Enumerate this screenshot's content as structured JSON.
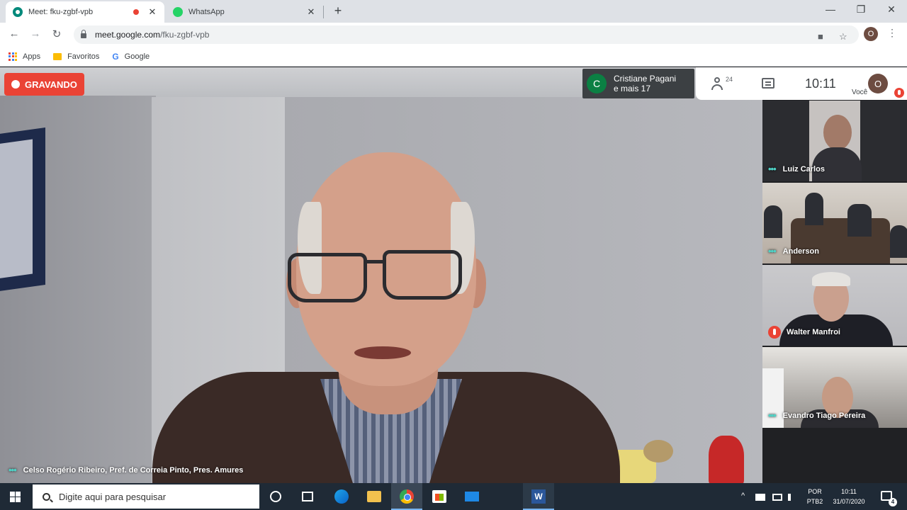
{
  "browser": {
    "tabs": [
      {
        "title": "Meet: fku-zgbf-vpb",
        "close": "✕",
        "recording": true
      },
      {
        "title": "WhatsApp",
        "close": "✕"
      }
    ],
    "new_tab": "+",
    "window_controls": {
      "minimize": "—",
      "maximize": "❐",
      "close": "✕"
    },
    "nav": {
      "back": "←",
      "forward": "→",
      "reload": "↻"
    },
    "url_host": "meet.google.com",
    "url_path": "/fku-zgbf-vpb",
    "profile_initial": "O",
    "menu": "⋮",
    "omnibox_icons": {
      "camera": "■",
      "star": "☆"
    },
    "bookmarks": [
      {
        "label": "Apps",
        "icon": "apps-grid-icon"
      },
      {
        "label": "Favoritos",
        "icon": "folder-icon"
      },
      {
        "label": "Google",
        "icon": "google-icon",
        "glyph": "G"
      }
    ]
  },
  "meet": {
    "recording_label": "GRAVANDO",
    "presenter": {
      "initial": "C",
      "line1": "Cristiane Pagani",
      "line2": "e mais 17",
      "avatar_color": "#0b8043"
    },
    "participants_count": "24",
    "clock": "10:11",
    "you_label": "Você",
    "you_initial": "O",
    "main_speaker": "Celso Rogério Ribeiro, Pref. de Correia Pinto, Pres. Amures",
    "speaking_dots": "•••",
    "tiles": [
      {
        "name": "Luiz Carlos",
        "indicator": "•••"
      },
      {
        "name": "Anderson",
        "indicator": "•••"
      },
      {
        "name": "Walter Manfroi",
        "indicator": "mic-off"
      },
      {
        "name": "Evandro Tiago Pereira",
        "indicator": "•••"
      }
    ],
    "accent_red": "#ea4335"
  },
  "taskbar": {
    "search_placeholder": "Digite aqui para pesquisar",
    "word_label": "W",
    "tray_chevron": "^",
    "language": [
      "POR",
      "PTB2"
    ],
    "time": "10:11",
    "date": "31/07/2020",
    "notification_count": "4"
  }
}
